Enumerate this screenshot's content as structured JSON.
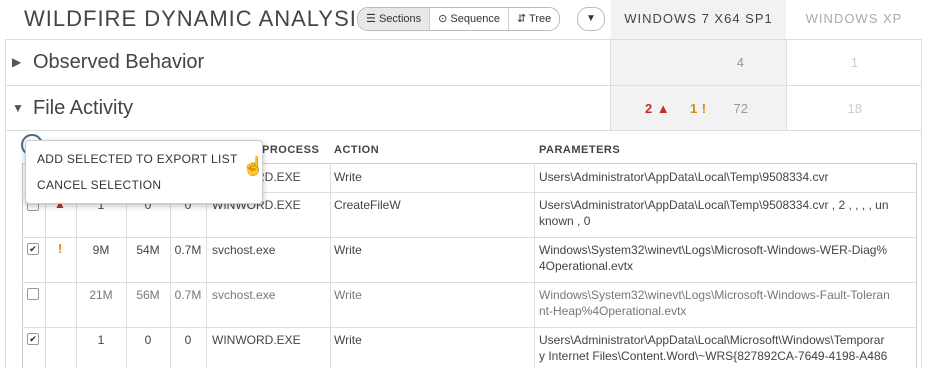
{
  "header": {
    "title": "WILDFIRE DYNAMIC ANALYSIS",
    "views": [
      "Sections",
      "Sequence",
      "Tree"
    ],
    "active_view": "Sections",
    "tabs": [
      "WINDOWS 7 X64 SP1",
      "WINDOWS XP"
    ]
  },
  "sections": {
    "observed": {
      "label": "Observed Behavior",
      "win7_count": "4",
      "xp_count": "1"
    },
    "file_activity": {
      "label": "File Activity",
      "high": "2",
      "medium": "1",
      "low": "72",
      "xp_count": "18"
    }
  },
  "table": {
    "headers": {
      "process": "PROCESS",
      "action": "ACTION",
      "parameters": "PARAMETERS"
    },
    "rows": [
      {
        "checked": false,
        "risk": "",
        "c1": "",
        "c2": "",
        "c3": "",
        "process": "WINWORD.EXE",
        "action": "Write",
        "p1": "Users\\Administrator\\AppData\\Local\\Temp\\9508334.cvr",
        "p2": "",
        "dim": false
      },
      {
        "checked": false,
        "risk": "high",
        "c1": "1",
        "c2": "0",
        "c3": "0",
        "process": "WINWORD.EXE",
        "action": "CreateFileW",
        "p1": "Users\\Administrator\\AppData\\Local\\Temp\\9508334.cvr , 2 , , , , un",
        "p2": "known , 0",
        "dim": false
      },
      {
        "checked": true,
        "risk": "medium",
        "c1": "9M",
        "c2": "54M",
        "c3": "0.7M",
        "process": "svchost.exe",
        "action": "Write",
        "p1": "Windows\\System32\\winevt\\Logs\\Microsoft-Windows-WER-Diag%",
        "p2": "4Operational.evtx",
        "dim": false
      },
      {
        "checked": false,
        "risk": "",
        "c1": "21M",
        "c2": "56M",
        "c3": "0.7M",
        "process": "svchost.exe",
        "action": "Write",
        "p1": "Windows\\System32\\winevt\\Logs\\Microsoft-Windows-Fault-Toleran",
        "p2": "nt-Heap%4Operational.evtx",
        "dim": true
      },
      {
        "checked": true,
        "risk": "",
        "c1": "1",
        "c2": "0",
        "c3": "0",
        "process": "WINWORD.EXE",
        "action": "Write",
        "p1": "Users\\Administrator\\AppData\\Local\\Microsoft\\Windows\\Temporar",
        "p2": "y Internet Files\\Content.Word\\~WRS{827892CA-7649-4198-A486",
        "dim": false
      }
    ]
  },
  "menu": {
    "add_label": "ADD SELECTED TO EXPORT LIST",
    "cancel_label": "CANCEL SELECTION"
  },
  "icons": {
    "warning_high": "warning-triangle-icon",
    "warning_medium": "exclamation-icon",
    "pointer": "hand-pointer-icon"
  },
  "colors": {
    "high": "#c0302f",
    "medium": "#d88a12"
  }
}
